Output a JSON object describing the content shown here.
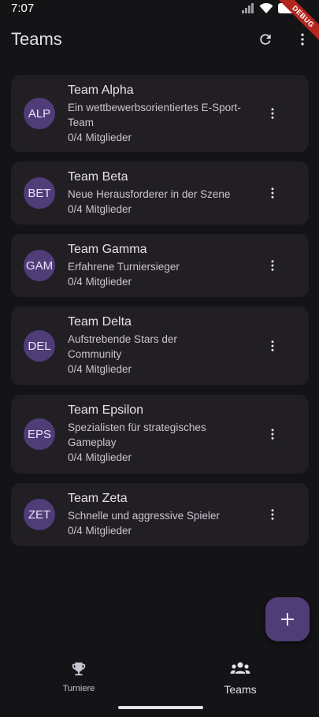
{
  "status_bar": {
    "time": "7:07",
    "debug_label": "DEBUG"
  },
  "app_bar": {
    "title": "Teams"
  },
  "teams": [
    {
      "initials": "ALP",
      "name": "Team Alpha",
      "description": "Ein wettbewerbsorientiertes E-Sport-Team",
      "members": "0/4 Mitglieder"
    },
    {
      "initials": "BET",
      "name": "Team Beta",
      "description": "Neue Herausforderer in der Szene",
      "members": "0/4 Mitglieder"
    },
    {
      "initials": "GAM",
      "name": "Team Gamma",
      "description": "Erfahrene Turniersieger",
      "members": "0/4 Mitglieder"
    },
    {
      "initials": "DEL",
      "name": "Team Delta",
      "description": "Aufstrebende Stars der Community",
      "members": "0/4 Mitglieder"
    },
    {
      "initials": "EPS",
      "name": "Team Epsilon",
      "description": "Spezialisten für strategisches Gameplay",
      "members": "0/4 Mitglieder"
    },
    {
      "initials": "ZET",
      "name": "Team Zeta",
      "description": "Schnelle und aggressive Spieler",
      "members": "0/4 Mitglieder"
    }
  ],
  "nav": {
    "turniere": {
      "label": "Turniere",
      "icon": "trophy-icon"
    },
    "teams": {
      "label": "Teams",
      "icon": "groups-icon"
    }
  },
  "colors": {
    "background": "#141316",
    "card": "#211f24",
    "accent": "#4f3d78",
    "text": "#e6e1e9"
  }
}
